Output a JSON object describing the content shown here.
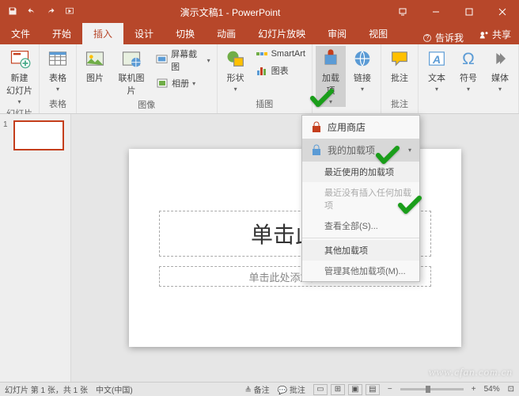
{
  "titlebar": {
    "doc_name": "演示文稿1",
    "app_name": "PowerPoint"
  },
  "tabs": {
    "file": "文件",
    "home": "开始",
    "insert": "插入",
    "design": "设计",
    "transitions": "切换",
    "animations": "动画",
    "slideshow": "幻灯片放映",
    "review": "审阅",
    "view": "视图",
    "tellme": "告诉我",
    "share": "共享"
  },
  "ribbon": {
    "new_slide": "新建\n幻灯片",
    "table": "表格",
    "pictures": "图片",
    "online_pictures": "联机图片",
    "screenshot": "屏幕截图",
    "photo_album": "相册",
    "shapes": "形状",
    "smartart": "SmartArt",
    "chart": "图表",
    "addins": "加载\n项",
    "hyperlink": "链接",
    "comment": "批注",
    "text": "文本",
    "symbols": "符号",
    "media": "媒体",
    "group_slides": "幻灯片",
    "group_tables": "表格",
    "group_images": "图像",
    "group_illustrations": "插图",
    "group_links": "",
    "group_comments": "批注"
  },
  "dropdown": {
    "store": "应用商店",
    "my_addins": "我的加载项",
    "recent": "最近使用的加载项",
    "no_recent": "最近没有插入任何加载项",
    "see_all": "查看全部(S)...",
    "other": "其他加载项",
    "manage_other": "管理其他加载项(M)..."
  },
  "slide": {
    "title_placeholder": "单击此处添加标题",
    "title_visible": "单击此处",
    "subtitle_placeholder": "单击此处添加副标题"
  },
  "statusbar": {
    "slide_info": "幻灯片 第 1 张，共 1 张",
    "lang": "中文(中国)",
    "notes": "备注",
    "comments": "批注",
    "zoom": "54%"
  },
  "thumbs": {
    "current": "1"
  },
  "watermark": "www.cfan.com.cn"
}
